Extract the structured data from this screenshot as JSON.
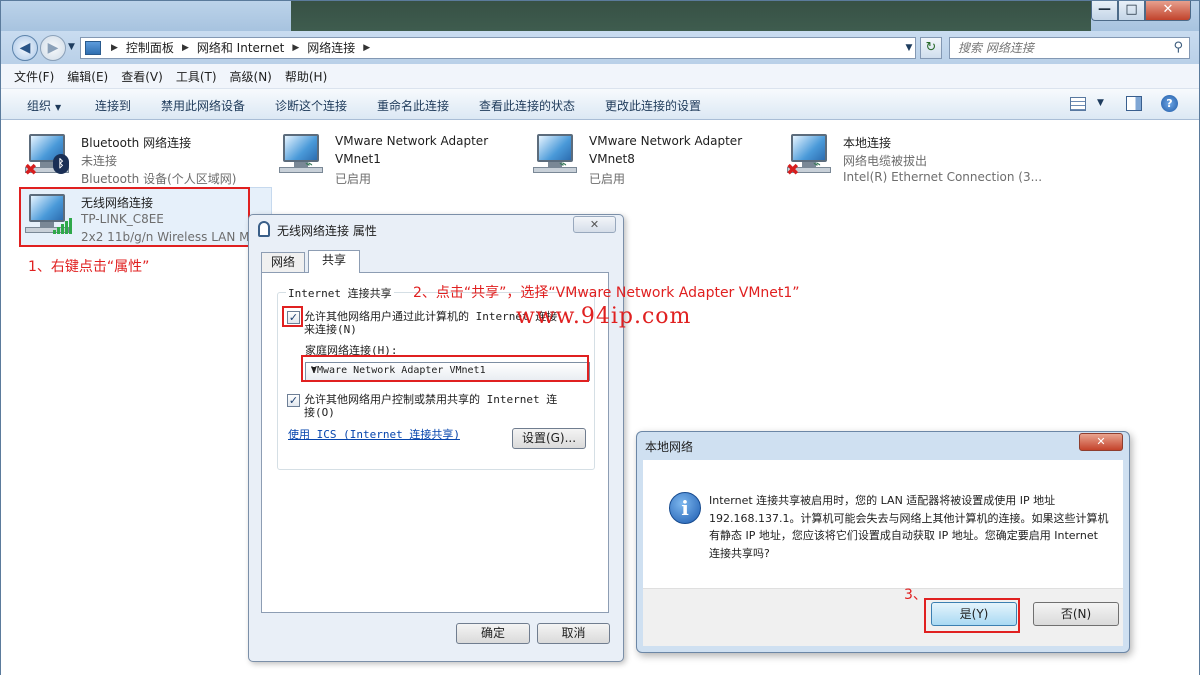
{
  "window": {
    "min_label": "—",
    "max_label": "□",
    "close_label": "✕"
  },
  "nav": {
    "back_label": "◀",
    "fwd_label": "▶",
    "breadcrumbs": [
      "控制面板",
      "网络和 Internet",
      "网络连接"
    ],
    "search_placeholder": "搜索 网络连接"
  },
  "menu": [
    "文件(F)",
    "编辑(E)",
    "查看(V)",
    "工具(T)",
    "高级(N)",
    "帮助(H)"
  ],
  "commands": {
    "organize": "组织",
    "connect": "连接到",
    "disable": "禁用此网络设备",
    "diagnose": "诊断这个连接",
    "rename": "重命名此连接",
    "status": "查看此连接的状态",
    "settings": "更改此连接的设置"
  },
  "connections": [
    {
      "name": "Bluetooth 网络连接",
      "status": "未连接",
      "device": "Bluetooth 设备(个人区域网)"
    },
    {
      "name": "VMware Network Adapter",
      "status": "VMnet1",
      "device": "已启用"
    },
    {
      "name": "VMware Network Adapter",
      "status": "VMnet8",
      "device": "已启用"
    },
    {
      "name": "本地连接",
      "status": "网络电缆被拔出",
      "device": "Intel(R) Ethernet Connection (3..."
    },
    {
      "name": "无线网络连接",
      "status": "TP-LINK_C8EE",
      "device": "2x2 11b/g/n Wireless LAN M"
    }
  ],
  "annotations": {
    "step1": "1、右键点击“属性”",
    "step2": "2、点击“共享”，选择“VMware Network Adapter VMnet1”",
    "step3": "3、",
    "watermark": "www.94ip.com"
  },
  "properties_dialog": {
    "title": "无线网络连接 属性",
    "close": "✕",
    "tab_network": "网络",
    "tab_sharing": "共享",
    "group_title": "Internet 连接共享",
    "allow_share_line1": "允许其他网络用户通过此计算机的 Internet 连接",
    "allow_share_line2": "来连接(N)",
    "home_network_label": "家庭网络连接(H):",
    "home_network_value": "VMware Network Adapter VMnet1",
    "allow_control_line1": "允许其他网络用户控制或禁用共享的 Internet 连",
    "allow_control_line2": "接(O)",
    "ics_link": "使用 ICS (Internet 连接共享)",
    "settings_button": "设置(G)...",
    "ok": "确定",
    "cancel": "取消"
  },
  "message_box": {
    "title": "本地网络",
    "close": "✕",
    "icon_glyph": "i",
    "text": "Internet 连接共享被启用时，您的 LAN 适配器将被设置成使用 IP 地址 192.168.137.1。计算机可能会失去与网络上其他计算机的连接。如果这些计算机有静态 IP 地址，您应该将它们设置成自动获取 IP 地址。您确定要启用 Internet 连接共享吗?",
    "yes": "是(Y)",
    "no": "否(N)"
  }
}
